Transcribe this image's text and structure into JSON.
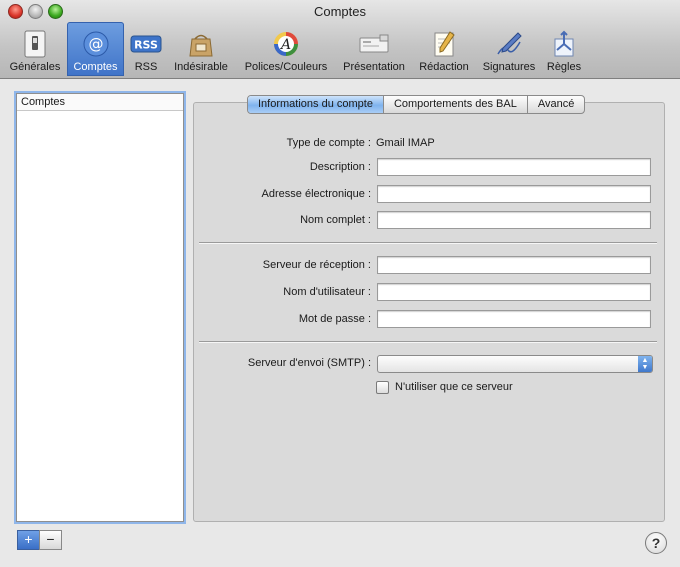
{
  "window": {
    "title": "Comptes"
  },
  "toolbar": {
    "items": [
      {
        "label": "Générales",
        "icon": "switch-icon"
      },
      {
        "label": "Comptes",
        "icon": "at-sign-icon",
        "selected": true
      },
      {
        "label": "RSS",
        "icon": "rss-icon",
        "badge": "RSS"
      },
      {
        "label": "Indésirable",
        "icon": "junk-mail-bag-icon"
      },
      {
        "label": "Polices/Couleurs",
        "icon": "font-colors-icon",
        "glyph": "A"
      },
      {
        "label": "Présentation",
        "icon": "presentation-icon"
      },
      {
        "label": "Rédaction",
        "icon": "compose-pencil-icon"
      },
      {
        "label": "Signatures",
        "icon": "signature-pen-icon"
      },
      {
        "label": "Règles",
        "icon": "rules-icon"
      }
    ]
  },
  "sidebar": {
    "header": "Comptes",
    "add_label": "+",
    "remove_label": "−"
  },
  "tabs": [
    {
      "label": "Informations du compte",
      "active": true
    },
    {
      "label": "Comportements des BAL"
    },
    {
      "label": "Avancé"
    }
  ],
  "form": {
    "account_type_label": "Type de compte :",
    "account_type_value": "Gmail IMAP",
    "description_label": "Description :",
    "description_value": "",
    "email_label": "Adresse électronique :",
    "email_value": "",
    "fullname_label": "Nom complet :",
    "fullname_value": "",
    "incoming_server_label": "Serveur de réception :",
    "incoming_server_value": "",
    "username_label": "Nom d'utilisateur :",
    "username_value": "",
    "password_label": "Mot de passe :",
    "password_value": "",
    "smtp_label": "Serveur d'envoi (SMTP) :",
    "smtp_value": "",
    "only_server_label": "N'utiliser que ce serveur",
    "only_server_checked": false
  },
  "help": {
    "label": "?"
  },
  "colors": {
    "selected_toolbar": "#3f73c8",
    "active_tab": "#7fb3ee",
    "close": "#d9352a",
    "minimize": "#b9b9b9",
    "zoom": "#3aa81e"
  }
}
